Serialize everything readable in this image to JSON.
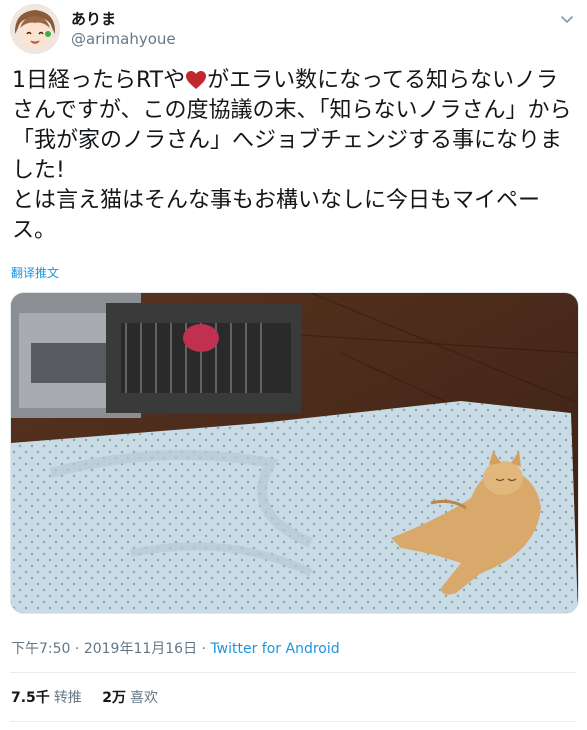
{
  "user": {
    "display_name": "ありま",
    "handle": "@arimahyoue"
  },
  "tweet": {
    "text_part1": "1日経ったらRTや",
    "text_part2": "がエラい数になってる知らないノラさんですが、この度協議の末、「知らないノラさん」から「我が家のノラさん」へジョブチェンジする事になりました!\nとは言え猫はそんな事もお構いなしに今日もマイペース。",
    "heart_color": "#c1272d"
  },
  "translate_label": "翻译推文",
  "meta": {
    "time": "下午7:50",
    "separator": " · ",
    "date": "2019年11月16日",
    "source": "Twitter for Android"
  },
  "stats": {
    "retweets_count": "7.5千",
    "retweets_label": "转推",
    "likes_count": "2万",
    "likes_label": "喜欢"
  },
  "icons": {
    "caret": "chevron-down-icon",
    "heart": "heart-icon"
  },
  "colors": {
    "link": "#1b95e0",
    "secondary_text": "#657786"
  }
}
